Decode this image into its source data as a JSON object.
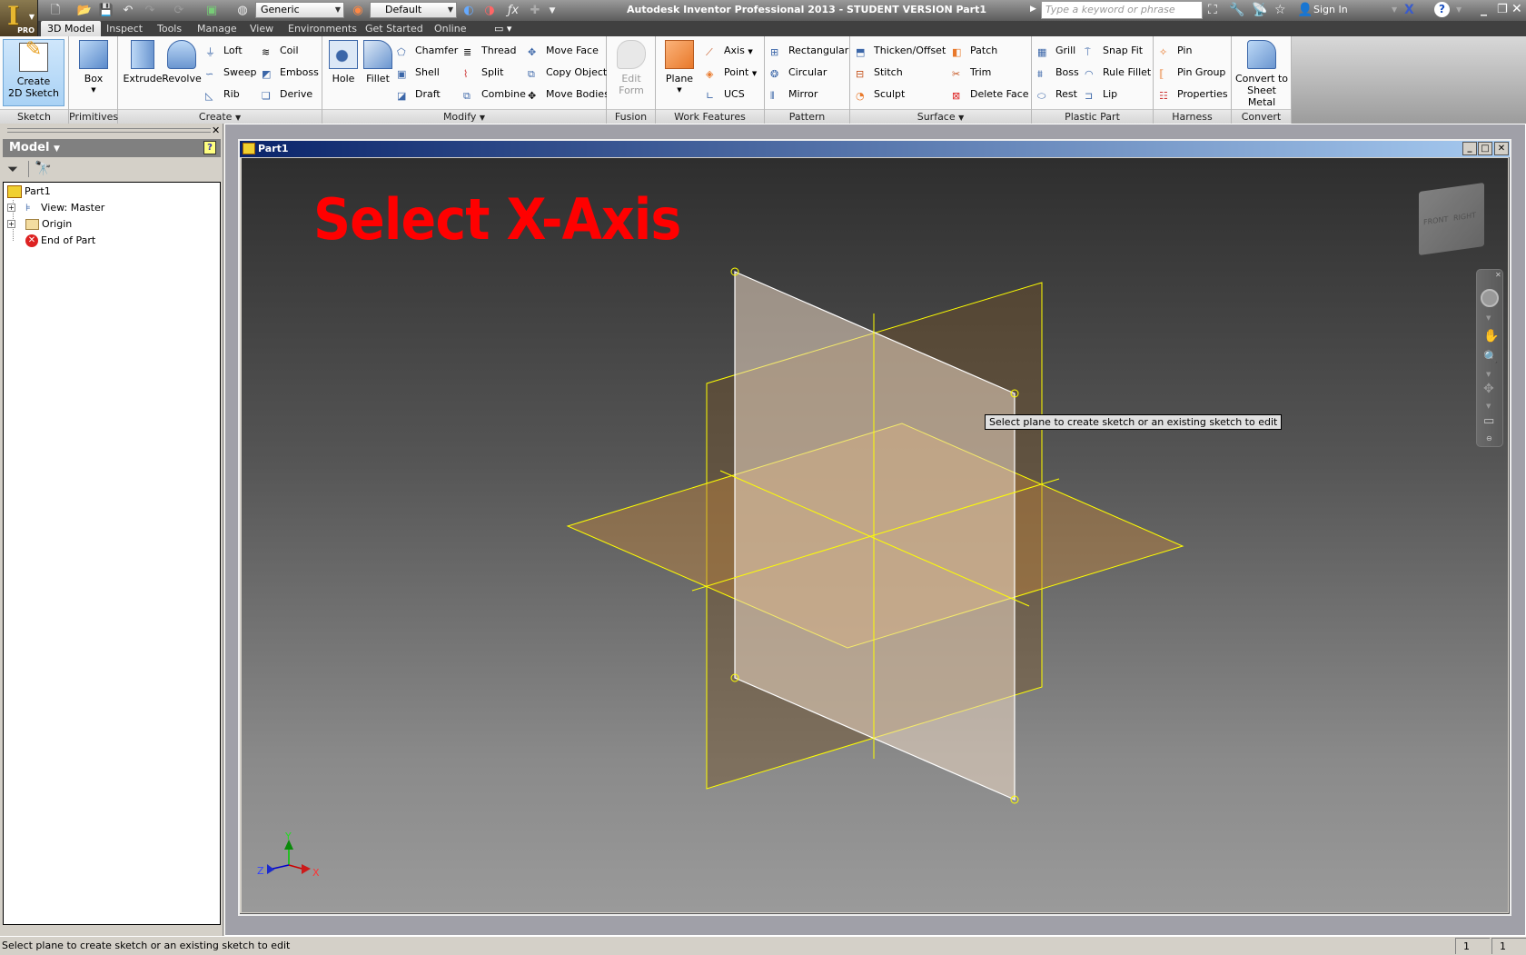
{
  "app": {
    "title": "Autodesk Inventor Professional 2013 - STUDENT VERSION    Part1",
    "app_button_badge": "PRO",
    "search_placeholder": "Type a keyword or phrase",
    "sign_in": "Sign In",
    "appearance_combo": "Generic",
    "material_combo": "Default"
  },
  "tabs": [
    {
      "label": "3D Model",
      "active": true
    },
    {
      "label": "Inspect"
    },
    {
      "label": "Tools"
    },
    {
      "label": "Manage"
    },
    {
      "label": "View"
    },
    {
      "label": "Environments"
    },
    {
      "label": "Get Started"
    },
    {
      "label": "Online"
    }
  ],
  "ribbon": {
    "sketch": {
      "label": "Sketch",
      "create_2d_sketch_l1": "Create",
      "create_2d_sketch_l2": "2D Sketch"
    },
    "primitives": {
      "label": "Primitives",
      "box": "Box"
    },
    "create": {
      "label": "Create",
      "extrude": "Extrude",
      "revolve": "Revolve",
      "loft": "Loft",
      "sweep": "Sweep",
      "rib": "Rib",
      "coil": "Coil",
      "emboss": "Emboss",
      "derive": "Derive"
    },
    "modify": {
      "label": "Modify",
      "hole": "Hole",
      "fillet": "Fillet",
      "chamfer": "Chamfer",
      "shell": "Shell",
      "draft": "Draft",
      "thread": "Thread",
      "split": "Split",
      "combine": "Combine",
      "move_face": "Move Face",
      "copy_object": "Copy Object",
      "move_bodies": "Move Bodies"
    },
    "fusion": {
      "label": "Fusion",
      "edit_form_l1": "Edit",
      "edit_form_l2": "Form"
    },
    "work_features": {
      "label": "Work Features",
      "plane": "Plane",
      "axis": "Axis",
      "point": "Point",
      "ucs": "UCS"
    },
    "pattern": {
      "label": "Pattern",
      "rectangular": "Rectangular",
      "circular": "Circular",
      "mirror": "Mirror"
    },
    "surface": {
      "label": "Surface",
      "thicken": "Thicken/Offset",
      "stitch": "Stitch",
      "sculpt": "Sculpt",
      "patch": "Patch",
      "trim": "Trim",
      "delete_face": "Delete Face"
    },
    "plastic_part": {
      "label": "Plastic Part",
      "grill": "Grill",
      "boss": "Boss",
      "rest": "Rest",
      "snap_fit": "Snap Fit",
      "rule_fillet": "Rule Fillet",
      "lip": "Lip"
    },
    "harness": {
      "label": "Harness",
      "pin": "Pin",
      "pin_group": "Pin Group",
      "properties": "Properties"
    },
    "convert": {
      "label": "Convert",
      "convert_l1": "Convert to",
      "convert_l2": "Sheet Metal"
    }
  },
  "browser": {
    "header": "Model",
    "tree": [
      {
        "label": "Part1",
        "icon": "part-icon"
      },
      {
        "label": "View: Master",
        "icon": "view-rep-icon"
      },
      {
        "label": "Origin",
        "icon": "folder-icon"
      },
      {
        "label": "End of Part",
        "icon": "end-of-part-icon"
      }
    ]
  },
  "document": {
    "title": "Part1",
    "banner": "Select X-Axis",
    "tooltip": "Select plane to create sketch or an existing sketch to edit",
    "viewcube": {
      "front": "FRONT",
      "right": "RIGHT"
    },
    "triad": {
      "x": "X",
      "y": "Y",
      "z": "Z"
    }
  },
  "status": {
    "message": "Select plane to create sketch or an existing sketch to edit",
    "count1": "1",
    "count2": "1"
  },
  "colors": {
    "plane_edge": "#ffff00",
    "banner": "#ff0000",
    "title_gradient_start": "#0a246a"
  }
}
